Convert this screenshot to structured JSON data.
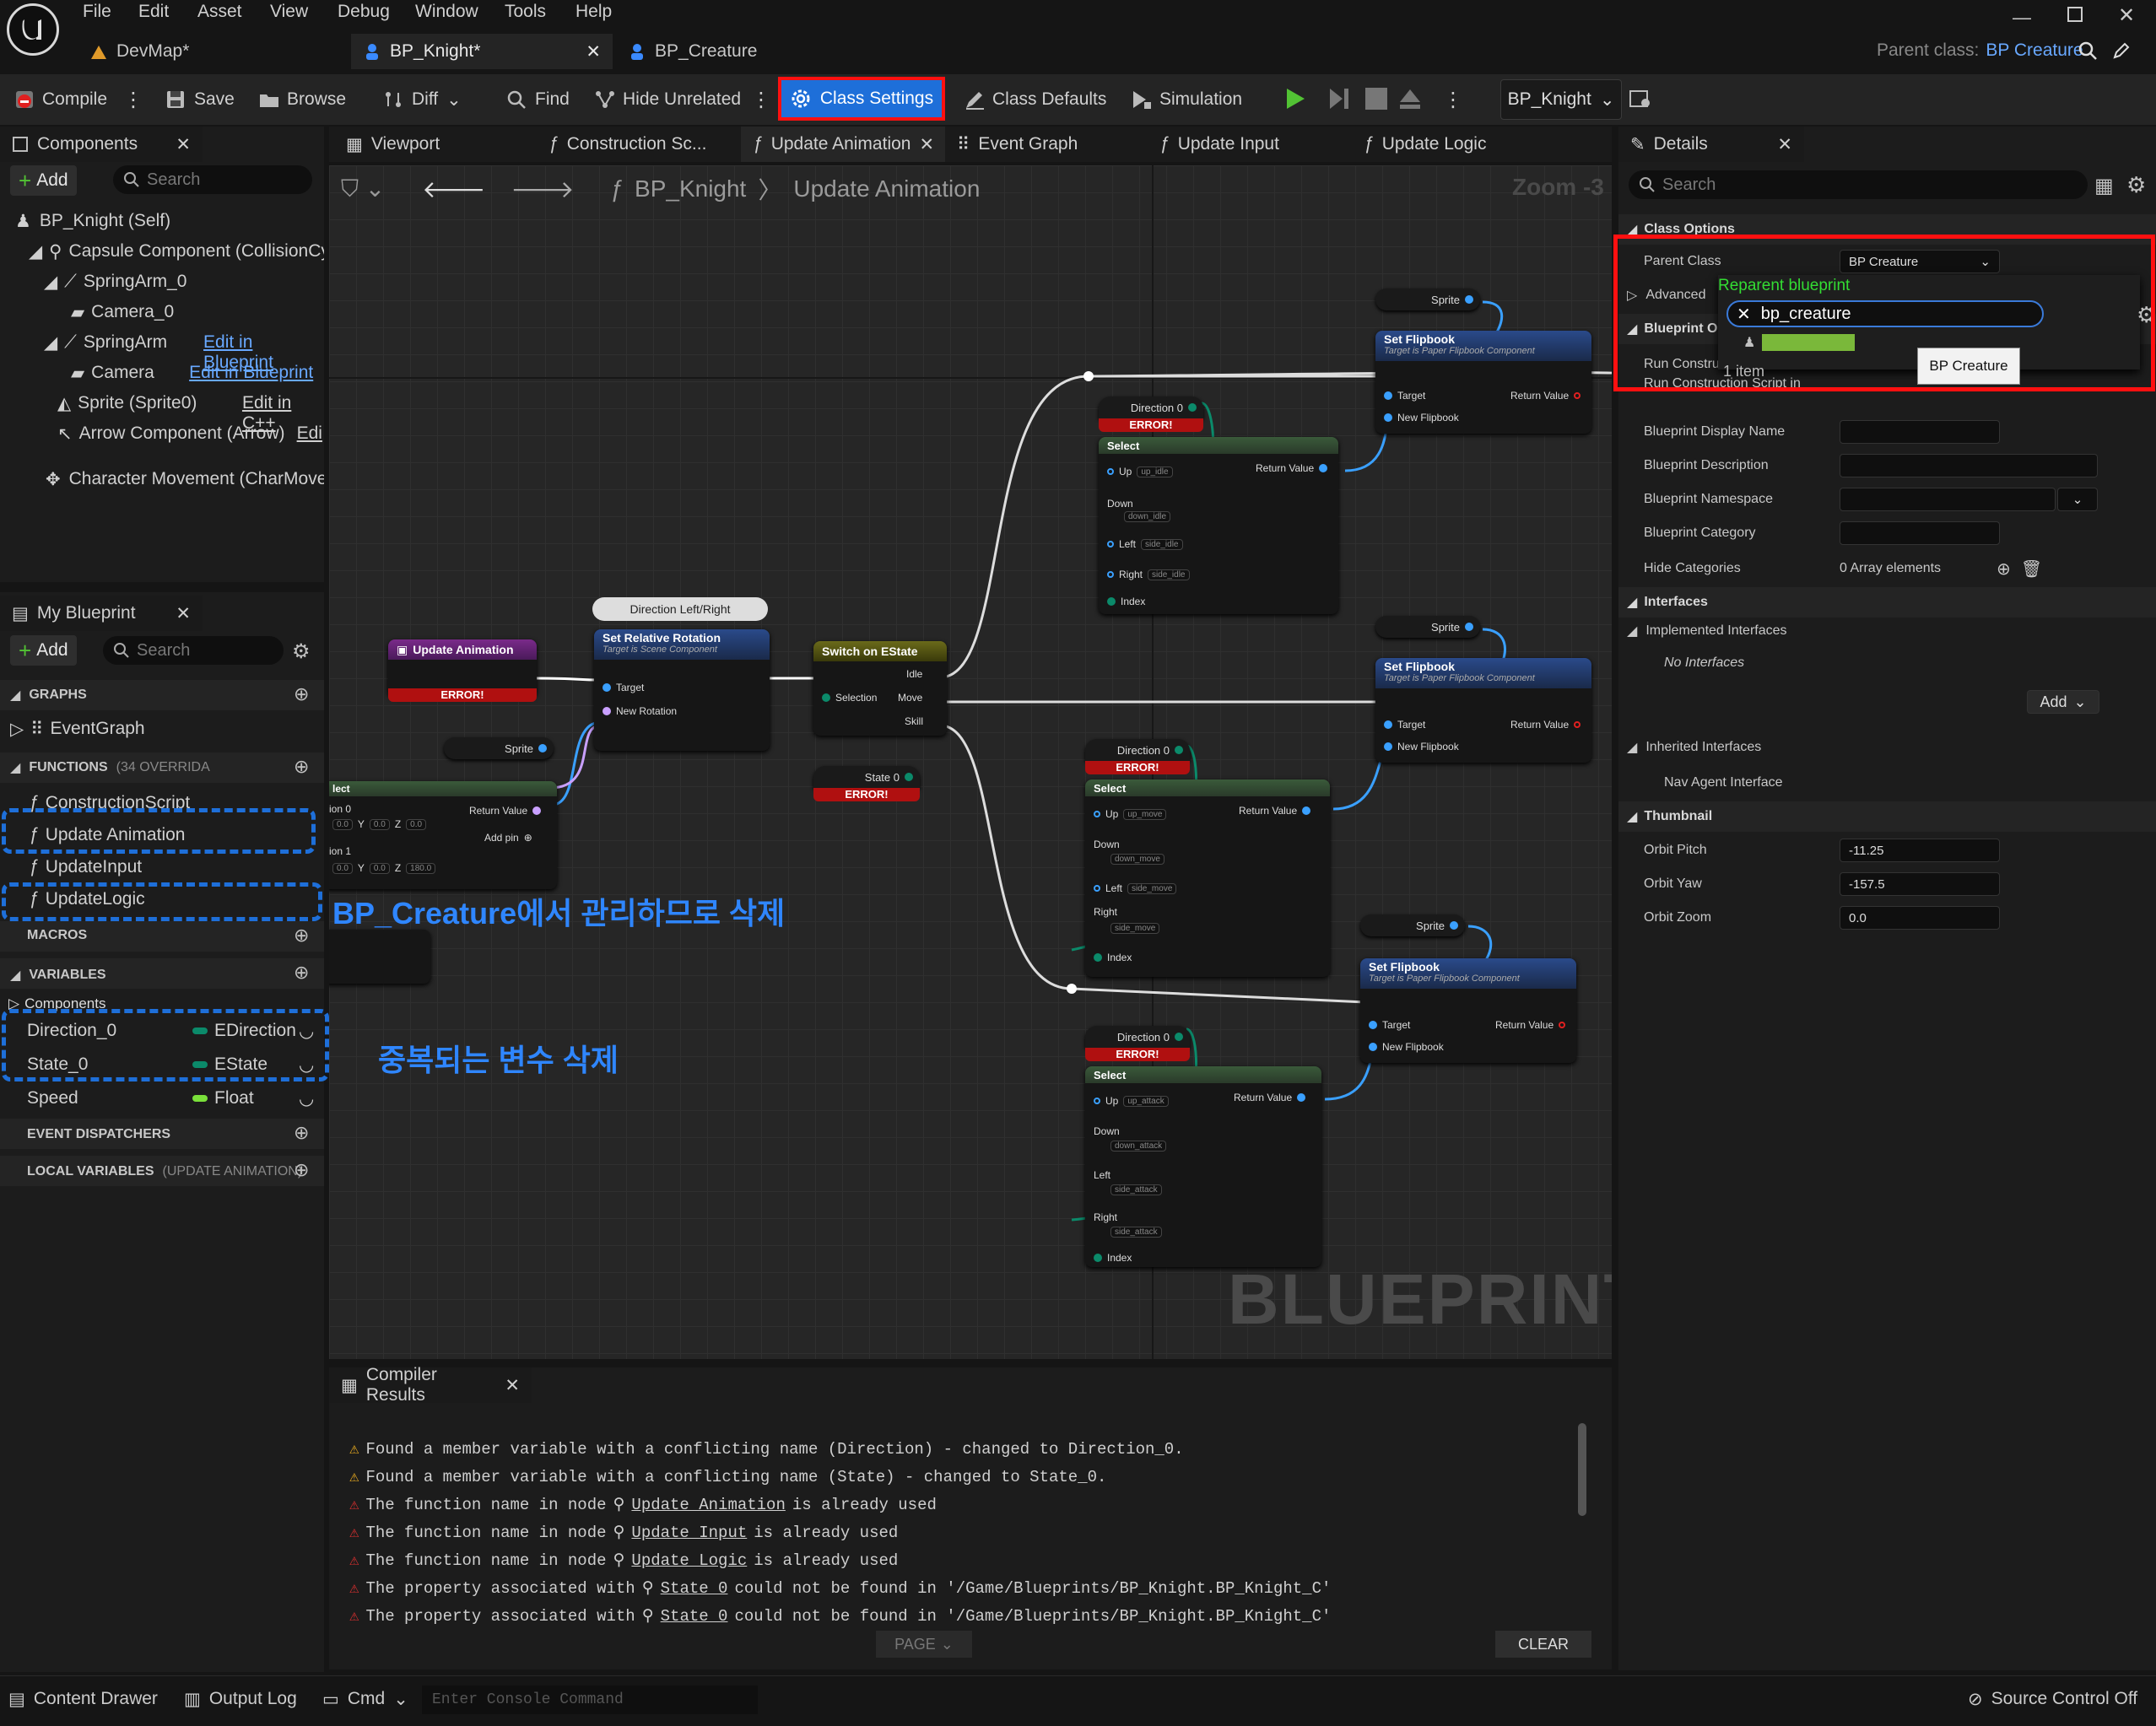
{
  "menu": [
    "File",
    "Edit",
    "Asset",
    "View",
    "Debug",
    "Window",
    "Tools",
    "Help"
  ],
  "tabs": [
    {
      "label": "DevMap*"
    },
    {
      "label": "BP_Knight*"
    },
    {
      "label": "BP_Creature"
    }
  ],
  "parent_class_label": "Parent class:",
  "parent_class_value": "BP Creature",
  "toolbar": {
    "compile": "Compile",
    "save": "Save",
    "browse": "Browse",
    "diff": "Diff",
    "find": "Find",
    "hide_unrelated": "Hide Unrelated",
    "class_settings": "Class Settings",
    "class_defaults": "Class Defaults",
    "simulation": "Simulation",
    "bp_selector": "BP_Knight"
  },
  "components": {
    "title": "Components",
    "add": "Add",
    "search_placeholder": "Search",
    "items": [
      {
        "label": "BP_Knight (Self)",
        "extra": ""
      },
      {
        "label": "Capsule Component (CollisionCy",
        "extra": ""
      },
      {
        "label": "SpringArm_0",
        "extra": ""
      },
      {
        "label": "Camera_0",
        "extra": ""
      },
      {
        "label": "SpringArm",
        "extra": "Edit in Blueprint"
      },
      {
        "label": "Camera",
        "extra": "Edit in Blueprint"
      },
      {
        "label": "Sprite (Sprite0)",
        "extra": "Edit in C++"
      },
      {
        "label": "Arrow Component (Arrow)",
        "extra": "Edi"
      },
      {
        "label": "Character Movement (CharMove",
        "extra": ""
      }
    ]
  },
  "mybp": {
    "title": "My Blueprint",
    "add": "Add",
    "search_placeholder": "Search",
    "graphs": "GRAPHS",
    "eventgraph": "EventGraph",
    "functions": "FUNCTIONS",
    "functions_count": "(34 OVERRIDA",
    "funcs": [
      "ConstructionScript",
      "Update Animation",
      "UpdateInput",
      "UpdateLogic"
    ],
    "macros": "MACROS",
    "variables": "VARIABLES",
    "components_cat": "Components",
    "vars": [
      {
        "name": "Direction_0",
        "type": "EDirection",
        "color": "#0b8a6a"
      },
      {
        "name": "State_0",
        "type": "EState",
        "color": "#0b8a6a"
      },
      {
        "name": "Speed",
        "type": "Float",
        "color": "#7ae03a"
      }
    ],
    "dispatchers": "EVENT DISPATCHERS",
    "local_vars": "LOCAL VARIABLES",
    "local_vars_sub": "(UPDATE ANIMATION)"
  },
  "graph_tabs": [
    "Viewport",
    "Construction Sc...",
    "Update Animation",
    "Event Graph",
    "Update Input",
    "Update Logic"
  ],
  "breadcrumb": {
    "root": "BP_Knight",
    "current": "Update Animation"
  },
  "zoom": "Zoom -3",
  "annotations": {
    "delete_funcs": "BP_Creature에서 관리하므로 삭제",
    "delete_vars": "중복되는 변수 삭제"
  },
  "nodes": {
    "update_anim": "Update Animation",
    "error": "ERROR!",
    "comment": "Direction Left/Right",
    "set_rel_rot": "Set Relative Rotation",
    "scene_comp": "Target is Scene Component",
    "target": "Target",
    "new_rotation": "New Rotation",
    "sprite": "Sprite",
    "select_frag": "lect",
    "option0": "ion 0",
    "option1": "ion 1",
    "return_value": "Return Value",
    "add_pin": "Add pin",
    "vec0": [
      "0.0",
      "0.0",
      "0.0"
    ],
    "vec1": [
      "0.0",
      "0.0",
      "180.0"
    ],
    "axes": [
      "X",
      "Y",
      "Z"
    ],
    "switch": "Switch on EState",
    "selection": "Selection",
    "idle": "Idle",
    "move": "Move",
    "skill": "Skill",
    "state0": "State 0",
    "direction0": "Direction 0",
    "select": "Select",
    "up": "Up",
    "down": "Down",
    "left": "Left",
    "right": "Right",
    "index": "Index",
    "set_flipbook": "Set Flipbook",
    "flip_comp": "Target is Paper Flipbook Component",
    "new_flipbook": "New Flipbook",
    "idle_opts": [
      "up_idle",
      "down_idle",
      "side_idle",
      "side_idle"
    ],
    "move_opts": [
      "up_move",
      "down_move",
      "side_move",
      "side_move"
    ],
    "attack_opts": [
      "up_attack",
      "down_attack",
      "side_attack",
      "side_attack"
    ]
  },
  "watermark": "BLUEPRINT",
  "compiler": {
    "title": "Compiler Results",
    "page": "PAGE",
    "clear": "CLEAR",
    "lines": [
      {
        "level": "warn",
        "pre": "Found a member variable with a conflicting name (Direction) - changed to Direction_0.",
        "link": "",
        "post": ""
      },
      {
        "level": "warn",
        "pre": "Found a member variable with a conflicting name (State) - changed to State_0.",
        "link": "",
        "post": ""
      },
      {
        "level": "err",
        "pre": "The function name in node",
        "link": "Update Animation",
        "post": "is already used"
      },
      {
        "level": "err",
        "pre": "The function name in node",
        "link": "Update Input",
        "post": "is already used"
      },
      {
        "level": "err",
        "pre": "The function name in node",
        "link": "Update Logic",
        "post": "is already used"
      },
      {
        "level": "err",
        "pre": "The property associated with",
        "link": "State 0",
        "post": "could not be found in '/Game/Blueprints/BP_Knight.BP_Knight_C'"
      },
      {
        "level": "err",
        "pre": "The property associated with",
        "link": "State 0",
        "post": "could not be found in '/Game/Blueprints/BP_Knight.BP_Knight_C'"
      }
    ]
  },
  "details": {
    "title": "Details",
    "search_placeholder": "Search",
    "class_options": "Class Options",
    "parent_class": "Parent Class",
    "parent_class_val": "BP Creature",
    "advanced": "Advanced",
    "reparent_title": "Reparent blueprint",
    "reparent_query": "bp_creature",
    "item_count": "1 item",
    "tooltip": "BP Creature",
    "bp_options": "Blueprint Op",
    "run_construct": "Run Constru",
    "run_construct2": "Run Construction Script in",
    "display_name": "Blueprint Display Name",
    "description": "Blueprint Description",
    "namespace": "Blueprint Namespace",
    "category": "Blueprint Category",
    "hide_categories": "Hide Categories",
    "array_elements": "0 Array elements",
    "interfaces": "Interfaces",
    "implemented": "Implemented Interfaces",
    "no_interfaces": "No Interfaces",
    "add": "Add",
    "inherited": "Inherited Interfaces",
    "nav_agent": "Nav Agent Interface",
    "thumbnail": "Thumbnail",
    "orbit_pitch": "Orbit Pitch",
    "orbit_pitch_val": "-11.25",
    "orbit_yaw": "Orbit Yaw",
    "orbit_yaw_val": "-157.5",
    "orbit_zoom": "Orbit Zoom",
    "orbit_zoom_val": "0.0"
  },
  "status": {
    "content_drawer": "Content Drawer",
    "output_log": "Output Log",
    "cmd": "Cmd",
    "console_placeholder": "Enter Console Command",
    "source_control": "Source Control Off"
  },
  "colors": {
    "accent": "#1e6fd9",
    "highlight_border": "#ff1010",
    "annotation": "#2f86ff",
    "reparent_green": "#33dd33",
    "error": "#b01010",
    "struct_pin": "#3aa0ff",
    "enum_pin": "#0b8a6a"
  }
}
